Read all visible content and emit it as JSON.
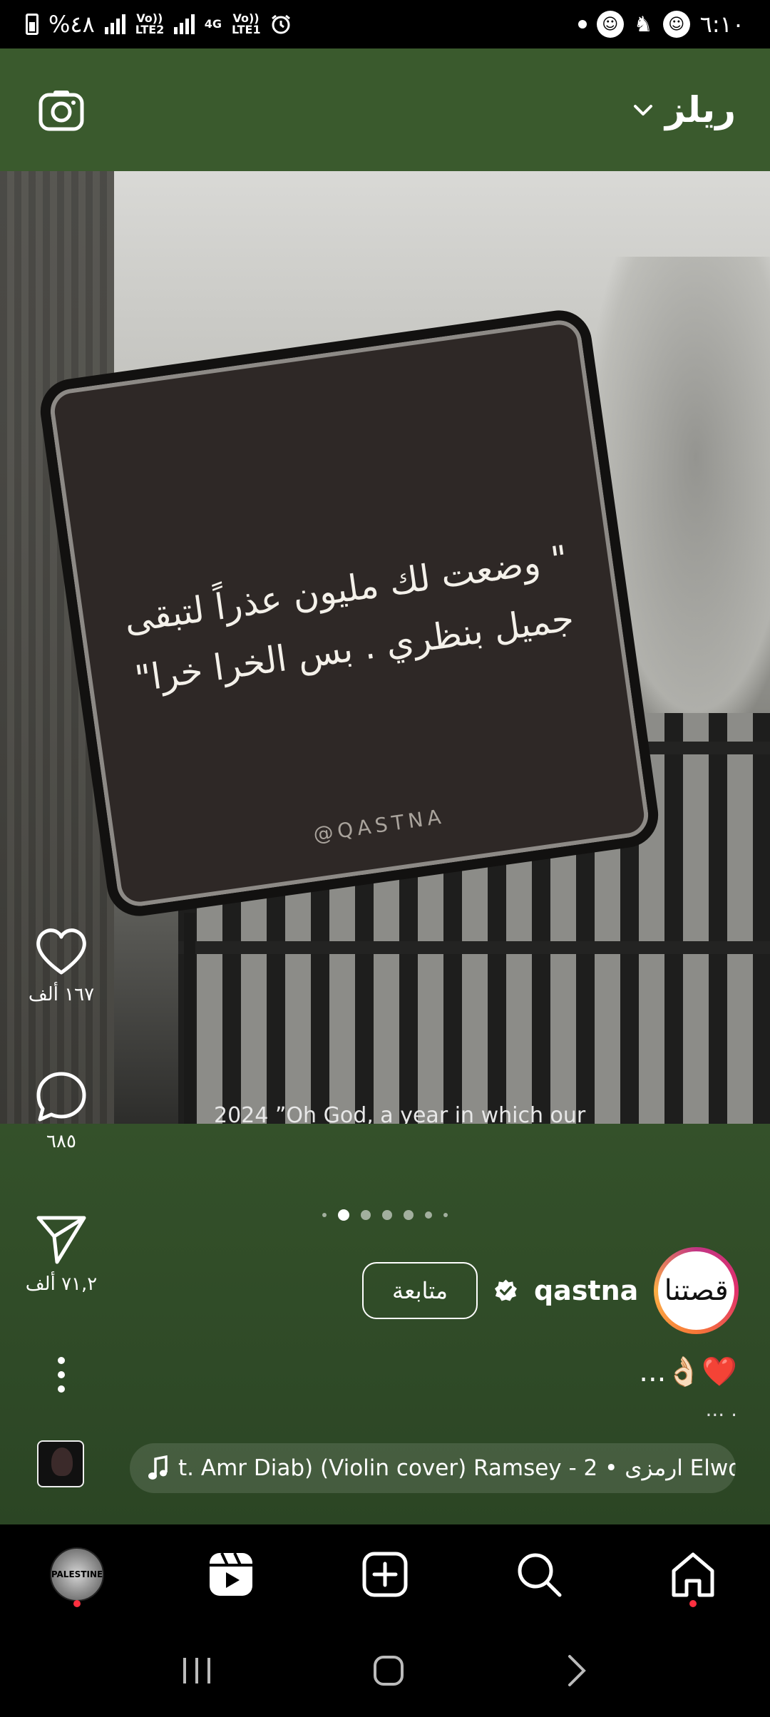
{
  "status_bar": {
    "battery_text": "%٤٨",
    "sim1": "Vo)) LTE2",
    "sim2_net": "4G",
    "sim2": "Vo)) LTE1",
    "time": "٦:١٠"
  },
  "header": {
    "title": "ريلز",
    "camera_icon": "camera-icon",
    "dropdown_icon": "chevron-down-icon"
  },
  "media": {
    "quote_line1": "\" وضعت لك مليون عذراً لتبقى",
    "quote_line2": "جميل بنظري . بس الخرا خرا\"",
    "watermark": "@QASTNA",
    "overlay_caption": "2024 ”Oh God, a year in which our"
  },
  "actions": {
    "likes": "١٦٧ ألف",
    "comments": "٦٨٥",
    "shares": "٧١,٢ ألف"
  },
  "carousel": {
    "total": 7,
    "active_index": 1
  },
  "author": {
    "username": "qastna",
    "follow_label": "متابعة",
    "avatar_text": "قصتنا"
  },
  "caption": {
    "text": "❤️👌🏻...",
    "more": "... ."
  },
  "audio": {
    "track": "t. Amr Diab) (Violin cover)    Ramsey - 2 • ارمزى Elwd"
  },
  "bottom_nav": {
    "profile_label": "PALESTINE",
    "icons": [
      "profile-avatar",
      "reels-icon",
      "create-icon",
      "search-icon",
      "home-icon"
    ]
  },
  "colors": {
    "header_bg": "#3a5a2d",
    "lower_bg": "#2f4a27",
    "notification_dot": "#ff3040"
  }
}
